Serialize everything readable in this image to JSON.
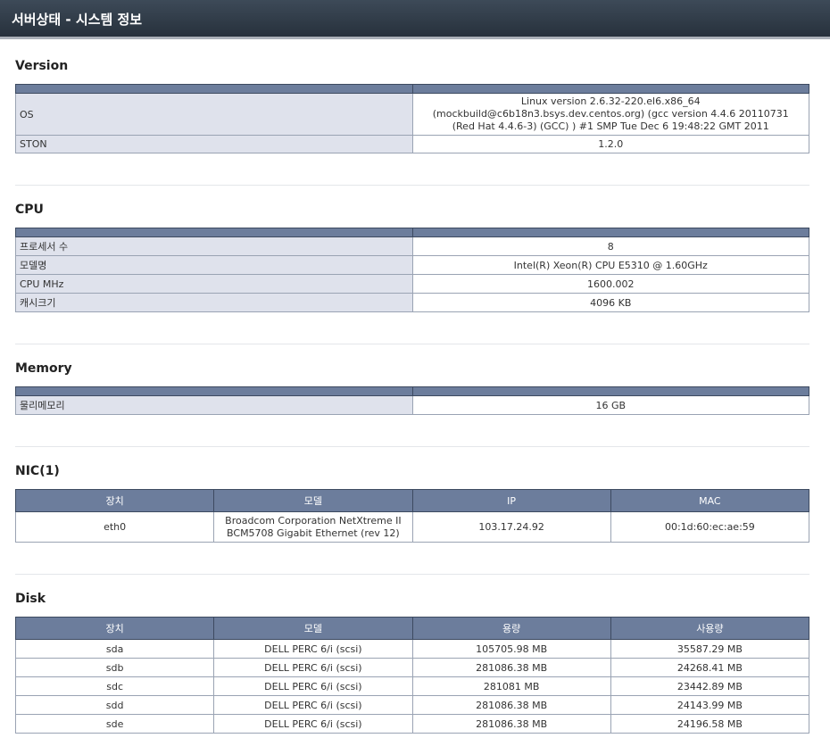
{
  "header": {
    "title": "서버상태 - 시스템 정보"
  },
  "version": {
    "title": "Version",
    "rows": [
      {
        "key": "OS",
        "value": "Linux version 2.6.32-220.el6.x86_64 (mockbuild@c6b18n3.bsys.dev.centos.org) (gcc version 4.4.6 20110731 (Red Hat 4.4.6-3) (GCC) ) #1 SMP Tue Dec 6 19:48:22 GMT 2011"
      },
      {
        "key": "STON",
        "value": "1.2.0"
      }
    ]
  },
  "cpu": {
    "title": "CPU",
    "rows": [
      {
        "key": "프로세서 수",
        "value": "8"
      },
      {
        "key": "모델명",
        "value": "Intel(R) Xeon(R) CPU E5310 @ 1.60GHz"
      },
      {
        "key": "CPU MHz",
        "value": "1600.002"
      },
      {
        "key": "캐시크기",
        "value": "4096 KB"
      }
    ]
  },
  "memory": {
    "title": "Memory",
    "rows": [
      {
        "key": "물리메모리",
        "value": "16 GB"
      }
    ]
  },
  "nic": {
    "title": "NIC(1)",
    "headers": [
      "장치",
      "모델",
      "IP",
      "MAC"
    ],
    "rows": [
      [
        "eth0",
        "Broadcom Corporation NetXtreme II BCM5708 Gigabit Ethernet (rev 12)",
        "103.17.24.92",
        "00:1d:60:ec:ae:59"
      ]
    ]
  },
  "disk": {
    "title": "Disk",
    "headers": [
      "장치",
      "모델",
      "용량",
      "사용량"
    ],
    "rows": [
      [
        "sda",
        "DELL PERC 6/i (scsi)",
        "105705.98 MB",
        "35587.29 MB"
      ],
      [
        "sdb",
        "DELL PERC 6/i (scsi)",
        "281086.38 MB",
        "24268.41 MB"
      ],
      [
        "sdc",
        "DELL PERC 6/i (scsi)",
        "281081 MB",
        "23442.89 MB"
      ],
      [
        "sdd",
        "DELL PERC 6/i (scsi)",
        "281086.38 MB",
        "24143.99 MB"
      ],
      [
        "sde",
        "DELL PERC 6/i (scsi)",
        "281086.38 MB",
        "24196.58 MB"
      ]
    ]
  }
}
